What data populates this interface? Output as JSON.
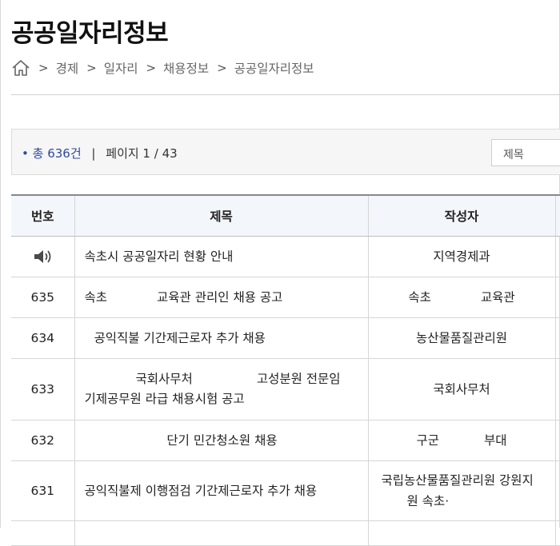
{
  "page": {
    "title": "공공일자리정보",
    "breadcrumb": [
      "경제",
      "일자리",
      "채용정보",
      "공공일자리정보"
    ]
  },
  "info": {
    "total": "총 636건",
    "page": "페이지 1 / 43",
    "search_select": "제목"
  },
  "table": {
    "headers": [
      "번호",
      "제목",
      "작성자"
    ],
    "rows": [
      {
        "number": "",
        "notice": true,
        "title": [
          "속초시 공공일자리 현황 안내"
        ],
        "writer": [
          "지역경제과"
        ]
      },
      {
        "number": "635",
        "title": [
          "속초",
          "교육관 관리인 채용 공고"
        ],
        "writer": [
          "속초",
          "교육관"
        ]
      },
      {
        "number": "634",
        "title": [
          "공익직불 기간제근로자 추가 채용"
        ],
        "writer": [
          "농산물품질관리원"
        ]
      },
      {
        "number": "633",
        "title": [
          "국회사무처",
          "고성분원 전문임",
          "기제공무원 라급 채용시험 공고"
        ],
        "writer": [
          "국회사무처"
        ]
      },
      {
        "number": "632",
        "title": [
          "단기 민간청소원 채용"
        ],
        "writer": [
          "구군",
          "부대"
        ]
      },
      {
        "number": "631",
        "title": [
          "공익직불제 이행점검 기간제근로자 추가 채용"
        ],
        "writer": [
          "국립농산물품질관리원 강원지",
          "원 속초·"
        ]
      }
    ]
  }
}
